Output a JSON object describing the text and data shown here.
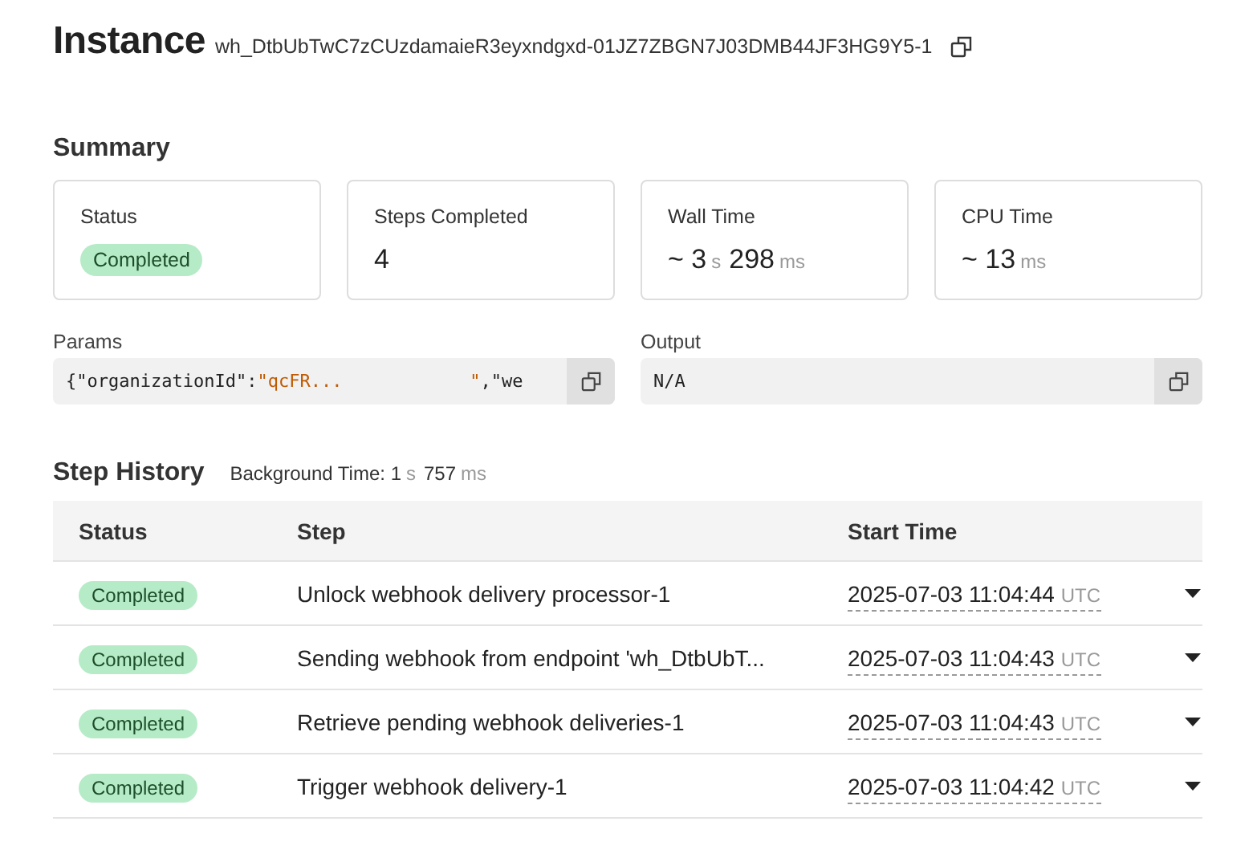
{
  "header": {
    "title": "Instance",
    "instance_id": "wh_DtbUbTwC7zCUzdamaieR3eyxndgxd-01JZ7ZBGN7J03DMB44JF3HG9Y5-1"
  },
  "summary": {
    "title": "Summary",
    "cards": [
      {
        "kind": "status",
        "label": "Status",
        "status": "Completed"
      },
      {
        "kind": "count",
        "label": "Steps Completed",
        "value": "4"
      },
      {
        "kind": "duration",
        "label": "Wall Time",
        "prefix": "~",
        "parts": [
          {
            "value": "3",
            "unit": "s"
          },
          {
            "value": "298",
            "unit": "ms"
          }
        ]
      },
      {
        "kind": "duration",
        "label": "CPU Time",
        "prefix": "~",
        "parts": [
          {
            "value": "13",
            "unit": "ms"
          }
        ]
      }
    ]
  },
  "params": {
    "label": "Params",
    "segments": [
      {
        "kind": "plain",
        "text": "{\"organizationId\":"
      },
      {
        "kind": "string",
        "text": "\"qcFR...            \""
      },
      {
        "kind": "plain",
        "text": ",\"we"
      }
    ]
  },
  "output": {
    "label": "Output",
    "value": "N/A"
  },
  "step_history": {
    "title": "Step History",
    "background_label": "Background Time:",
    "background_parts": [
      {
        "value": "1",
        "unit": "s"
      },
      {
        "value": "757",
        "unit": "ms"
      }
    ],
    "columns": [
      "Status",
      "Step",
      "Start Time"
    ],
    "rows": [
      {
        "status": "Completed",
        "step": "Unlock webhook delivery processor-1",
        "start": "2025-07-03 11:04:44",
        "tz": "UTC"
      },
      {
        "status": "Completed",
        "step": "Sending webhook from endpoint 'wh_DtbUbT...",
        "start": "2025-07-03 11:04:43",
        "tz": "UTC"
      },
      {
        "status": "Completed",
        "step": "Retrieve pending webhook deliveries-1",
        "start": "2025-07-03 11:04:43",
        "tz": "UTC"
      },
      {
        "status": "Completed",
        "step": "Trigger webhook delivery-1",
        "start": "2025-07-03 11:04:42",
        "tz": "UTC"
      }
    ]
  }
}
